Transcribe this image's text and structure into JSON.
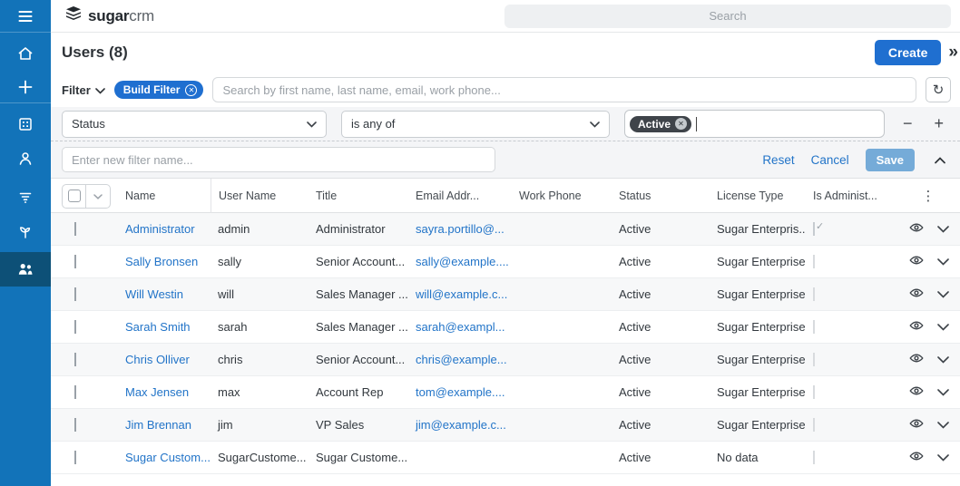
{
  "topbar": {
    "logo_bold": "sugar",
    "logo_light": "crm",
    "search_placeholder": "Search"
  },
  "sidebar": {
    "items": [
      {
        "icon": "menu-icon"
      },
      {
        "icon": "home-icon"
      },
      {
        "icon": "plus-icon"
      },
      {
        "icon": "accounts-icon"
      },
      {
        "icon": "contacts-icon"
      },
      {
        "icon": "leads-icon"
      },
      {
        "icon": "opportunities-icon"
      },
      {
        "icon": "users-icon",
        "active": true
      }
    ]
  },
  "page": {
    "title": "Users (8)",
    "create_label": "Create",
    "more_chevrons": "»"
  },
  "filter": {
    "filter_label": "Filter",
    "build_filter_chip": "Build Filter",
    "search_placeholder": "Search by first name, last name, email, work phone...",
    "field_selected": "Status",
    "operator_selected": "is any of",
    "value_chip": "Active",
    "name_placeholder": "Enter new filter name...",
    "reset_label": "Reset",
    "cancel_label": "Cancel",
    "save_label": "Save"
  },
  "table": {
    "columns": [
      "Name",
      "User Name",
      "Title",
      "Email Addr...",
      "Work Phone",
      "Status",
      "License Type",
      "Is Administ..."
    ],
    "rows": [
      {
        "name": "Administrator",
        "username": "admin",
        "title": "Administrator",
        "email": "sayra.portillo@...",
        "work_phone": "",
        "status": "Active",
        "license": "Sugar Enterpris...",
        "is_admin": true
      },
      {
        "name": "Sally Bronsen",
        "username": "sally",
        "title": "Senior Account...",
        "email": "sally@example....",
        "work_phone": "",
        "status": "Active",
        "license": "Sugar Enterprise",
        "is_admin": false
      },
      {
        "name": "Will Westin",
        "username": "will",
        "title": "Sales Manager ...",
        "email": "will@example.c...",
        "work_phone": "",
        "status": "Active",
        "license": "Sugar Enterprise",
        "is_admin": false
      },
      {
        "name": "Sarah Smith",
        "username": "sarah",
        "title": "Sales Manager ...",
        "email": "sarah@exampl...",
        "work_phone": "",
        "status": "Active",
        "license": "Sugar Enterprise",
        "is_admin": false
      },
      {
        "name": "Chris Olliver",
        "username": "chris",
        "title": "Senior Account...",
        "email": "chris@example...",
        "work_phone": "",
        "status": "Active",
        "license": "Sugar Enterprise",
        "is_admin": false
      },
      {
        "name": "Max Jensen",
        "username": "max",
        "title": "Account Rep",
        "email": "tom@example....",
        "work_phone": "",
        "status": "Active",
        "license": "Sugar Enterprise",
        "is_admin": false
      },
      {
        "name": "Jim Brennan",
        "username": "jim",
        "title": "VP Sales",
        "email": "jim@example.c...",
        "work_phone": "",
        "status": "Active",
        "license": "Sugar Enterprise",
        "is_admin": false
      },
      {
        "name": "Sugar Custom...",
        "username": "SugarCustome...",
        "title": "Sugar Custome...",
        "email": "",
        "work_phone": "",
        "status": "Active",
        "license": "No data",
        "is_admin": false
      }
    ]
  },
  "colors": {
    "sidebar_blue": "#1273b9",
    "sidebar_active": "#0d5077",
    "accent_blue": "#1f6fd0",
    "save_muted_blue": "#75abd8",
    "link_blue": "#2274c8",
    "chip_dark": "#3f444a",
    "panel_gray": "#f4f5f7"
  }
}
